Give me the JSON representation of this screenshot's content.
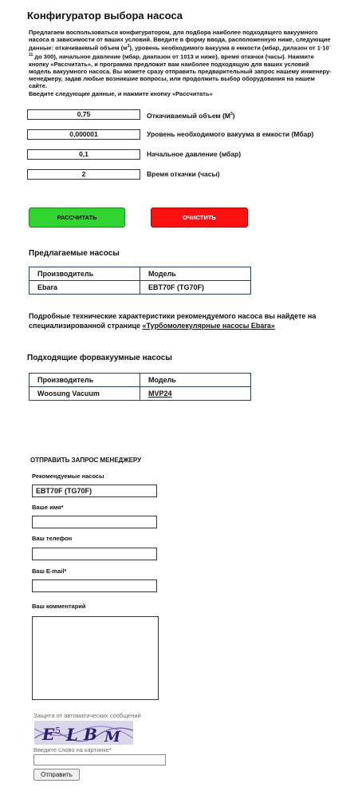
{
  "title": "Конфигуратор выбора насоса",
  "intro": {
    "p1_a": "Предлагаем воспользоваться конфигуратором, для подбора наиболее подходящего вакуумного насоса в зависимости от ваших условий. Введите в форму ввода, расположенную ниже, следующие данные: откачиваемый объем (м",
    "p1_sup1": "3",
    "p1_b": "), уровень необходимого вакуума в емкости (мбар, дилазон от 1·10",
    "p1_sup2": "-11",
    "p1_c": " до 300), начальное давление (мбар, диапазон от 1013 и ниже), время откачки (часы). Нажмите кнопку «Рассчитать», и программа предложит вам наиболее подходящую для ваших условий модель вакуумного насоса. Вы можете сразу отправить предварительный запрос нашему инженеру-менеджеру, задав любые возникшие вопросы, или продолжить выбор оборудования на нашем сайте.",
    "p2": "Введите следующие данные, и нажмите кнопку «Рассчитать»"
  },
  "fields": [
    {
      "value": "0,75",
      "label": "Откачиваемый объем (М",
      "label_sup": "3",
      "label_end": ")"
    },
    {
      "value": "0,000001",
      "label": "Уровень необходимого вакуума в емкости (Мбар)"
    },
    {
      "value": "0,1",
      "label": "Начальное давление (мбар)"
    },
    {
      "value": "2",
      "label": "Время откачки (часы)"
    }
  ],
  "buttons": {
    "calculate": "РАССЧИТАТЬ",
    "clear": "ОЧИСТИТЬ",
    "colors": {
      "calculate": "#31d431",
      "clear": "#ff1010"
    }
  },
  "pumps": {
    "title": "Предлагаемые насосы",
    "headers": [
      "Производитель",
      "Модель"
    ],
    "rows": [
      [
        "Ebara",
        "EBT70F (TG70F)"
      ]
    ]
  },
  "note": {
    "text": "Подробные технические характеристики рекомендуемого насоса вы найдете на специализированной странице ",
    "link": "«Турбомолекулярные насосы Ebara»"
  },
  "forevac": {
    "title": "Подходящие форвакуумные насосы",
    "headers": [
      "Производитель",
      "Модель"
    ],
    "rows": [
      [
        "Woosung Vacuum",
        "MVP24"
      ]
    ]
  },
  "form": {
    "heading": "ОТПРАВИТЬ ЗАПРОС МЕНЕДЖЕРУ",
    "recommended_label": "Рекомендуемые насосы",
    "recommended_value": "EBT70F (TG70F)",
    "name_label": "Ваше имя*",
    "phone_label": "Ваш телефон",
    "email_label": "Ваш E-mail*",
    "comment_label": "Ваш комментарий",
    "captcha_label": "Защита от автоматических сообщений",
    "captcha_hint": "Введите слово на картинке*",
    "submit": "Отправить"
  }
}
